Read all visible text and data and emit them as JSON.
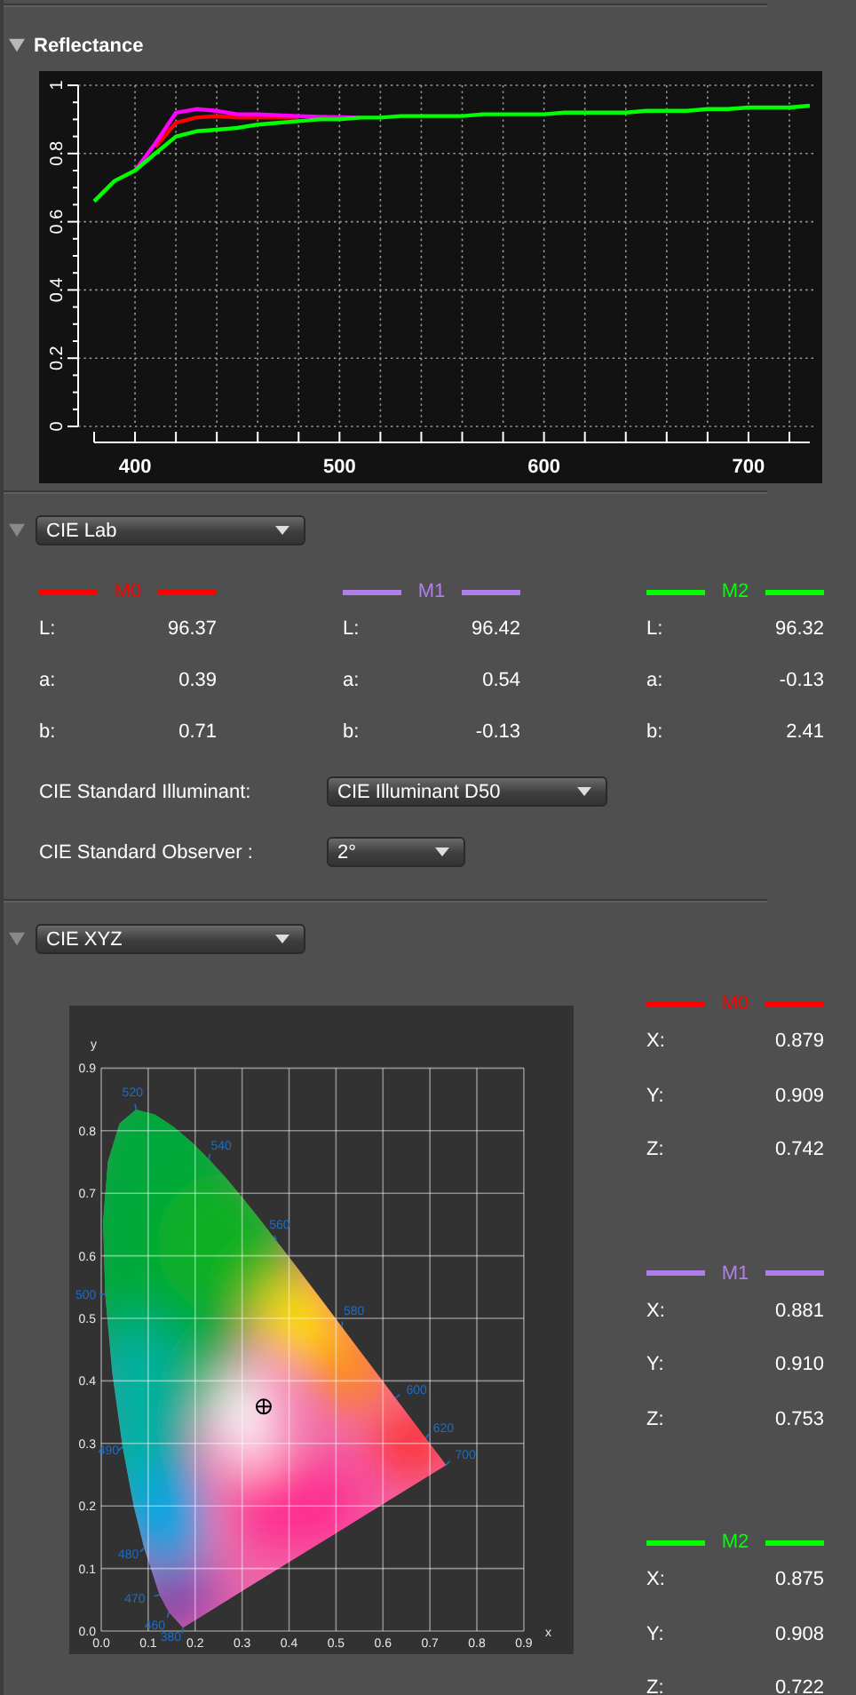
{
  "reflectance": {
    "title": "Reflectance",
    "expanded": true,
    "chart_data": {
      "type": "line",
      "grid": true,
      "xlim": [
        380,
        730
      ],
      "ylim": [
        0,
        1
      ],
      "xticks": [
        400,
        500,
        600,
        700
      ],
      "yticks": [
        {
          "value": 0,
          "label": "0"
        },
        {
          "value": 0.2,
          "label": "0.2"
        },
        {
          "value": 0.4,
          "label": "0.4"
        },
        {
          "value": 0.6,
          "label": "0.6"
        },
        {
          "value": 0.8,
          "label": "0.8"
        },
        {
          "value": 1,
          "label": "1"
        }
      ],
      "x": [
        380,
        390,
        400,
        410,
        420,
        430,
        440,
        450,
        460,
        470,
        480,
        490,
        500,
        510,
        520,
        530,
        540,
        550,
        560,
        570,
        580,
        590,
        600,
        610,
        620,
        630,
        640,
        650,
        660,
        670,
        680,
        690,
        700,
        710,
        720,
        730
      ],
      "series": [
        {
          "color": "#ff0000",
          "values": [
            null,
            null,
            null,
            0.82,
            0.89,
            0.905,
            0.91,
            0.905,
            0.905,
            0.905,
            0.905,
            null,
            null,
            null,
            null,
            null,
            null,
            null,
            null,
            null,
            null,
            null,
            null,
            null,
            null,
            null,
            null,
            null,
            null,
            null,
            null,
            null,
            null,
            null,
            null,
            null
          ]
        },
        {
          "color": "#ff00ff",
          "values": [
            null,
            null,
            0.75,
            0.83,
            0.92,
            0.93,
            0.925,
            0.915,
            0.915,
            0.912,
            0.91,
            0.908,
            0.906,
            0.905,
            null,
            null,
            null,
            null,
            null,
            null,
            null,
            null,
            null,
            null,
            null,
            null,
            null,
            null,
            null,
            null,
            null,
            null,
            null,
            null,
            null,
            null
          ]
        },
        {
          "color": "#00ff00",
          "values": [
            0.66,
            0.72,
            0.75,
            0.8,
            0.85,
            0.865,
            0.87,
            0.875,
            0.885,
            0.89,
            0.895,
            0.9,
            0.9,
            0.905,
            0.905,
            0.91,
            0.91,
            0.91,
            0.91,
            0.915,
            0.915,
            0.915,
            0.915,
            0.92,
            0.92,
            0.92,
            0.92,
            0.925,
            0.925,
            0.925,
            0.93,
            0.93,
            0.935,
            0.935,
            0.935,
            0.94
          ]
        }
      ]
    }
  },
  "cie_lab": {
    "selector": "CIE Lab",
    "expanded": true,
    "measurements": [
      {
        "name": "M0",
        "color": "#ff0000",
        "values": [
          {
            "label": "L:",
            "value": "96.37"
          },
          {
            "label": "a:",
            "value": "0.39"
          },
          {
            "label": "b:",
            "value": "0.71"
          }
        ]
      },
      {
        "name": "M1",
        "color": "#b07ee8",
        "values": [
          {
            "label": "L:",
            "value": "96.42"
          },
          {
            "label": "a:",
            "value": "0.54"
          },
          {
            "label": "b:",
            "value": "-0.13"
          }
        ]
      },
      {
        "name": "M2",
        "color": "#00ff00",
        "values": [
          {
            "label": "L:",
            "value": "96.32"
          },
          {
            "label": "a:",
            "value": "-0.13"
          },
          {
            "label": "b:",
            "value": "2.41"
          }
        ]
      }
    ],
    "settings": [
      {
        "label": "CIE Standard Illuminant:",
        "value": "CIE Illuminant D50"
      },
      {
        "label": "CIE Standard Observer :",
        "value": "2°"
      }
    ]
  },
  "cie_xyz": {
    "selector": "CIE XYZ",
    "expanded": true,
    "diagram": {
      "x_axis_label": "x",
      "y_axis_label": "y",
      "x_tick_labels": [
        "0.0",
        "0.1",
        "0.2",
        "0.3",
        "0.4",
        "0.5",
        "0.6",
        "0.7",
        "0.8",
        "0.9"
      ],
      "y_tick_labels": [
        "0.9",
        "0.8",
        "0.7",
        "0.6",
        "0.5",
        "0.4",
        "0.3",
        "0.2",
        "0.1",
        "0.0"
      ],
      "wavelength_labels": [
        "520",
        "540",
        "560",
        "580",
        "600",
        "620",
        "700",
        "500",
        "490",
        "480",
        "470",
        "460",
        "380"
      ]
    },
    "measurements": [
      {
        "name": "M0",
        "color": "#ff0000",
        "values": [
          {
            "label": "X:",
            "value": "0.879"
          },
          {
            "label": "Y:",
            "value": "0.909"
          },
          {
            "label": "Z:",
            "value": "0.742"
          }
        ]
      },
      {
        "name": "M1",
        "color": "#b07ee8",
        "values": [
          {
            "label": "X:",
            "value": "0.881"
          },
          {
            "label": "Y:",
            "value": "0.910"
          },
          {
            "label": "Z:",
            "value": "0.753"
          }
        ]
      },
      {
        "name": "M2",
        "color": "#00ff00",
        "values": [
          {
            "label": "X:",
            "value": "0.875"
          },
          {
            "label": "Y:",
            "value": "0.908"
          },
          {
            "label": "Z:",
            "value": "0.722"
          }
        ]
      }
    ]
  }
}
